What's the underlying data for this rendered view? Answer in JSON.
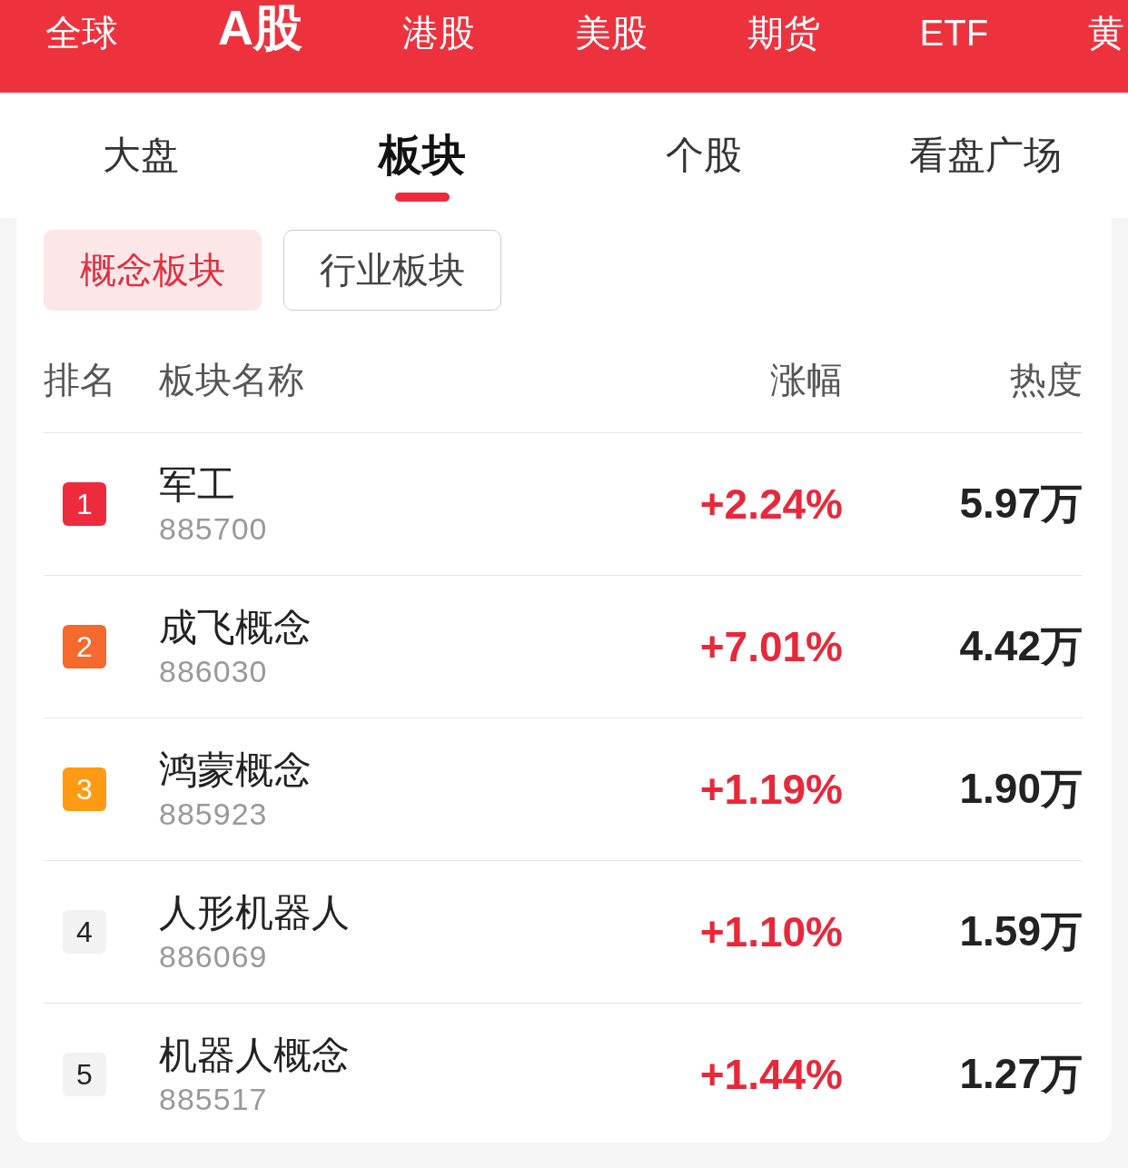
{
  "market_tabs": [
    {
      "label": "全球",
      "selected": false
    },
    {
      "label": "A股",
      "selected": true
    },
    {
      "label": "港股",
      "selected": false
    },
    {
      "label": "美股",
      "selected": false
    },
    {
      "label": "期货",
      "selected": false
    },
    {
      "label": "ETF",
      "selected": false
    },
    {
      "label": "黄",
      "selected": false
    }
  ],
  "section_tabs": [
    {
      "label": "大盘",
      "selected": false
    },
    {
      "label": "板块",
      "selected": true
    },
    {
      "label": "个股",
      "selected": false
    },
    {
      "label": "看盘广场",
      "selected": false
    }
  ],
  "category_toggle": [
    {
      "label": "概念板块",
      "selected": true
    },
    {
      "label": "行业板块",
      "selected": false
    }
  ],
  "table": {
    "columns": [
      "排名",
      "板块名称",
      "涨幅",
      "热度"
    ],
    "rows": [
      {
        "rank": "1",
        "name": "军工",
        "code": "885700",
        "change": "+2.24%",
        "heat": "5.97万",
        "color": "#ee2a3d"
      },
      {
        "rank": "2",
        "name": "成飞概念",
        "code": "886030",
        "change": "+7.01%",
        "heat": "4.42万",
        "color": "#f5692c"
      },
      {
        "rank": "3",
        "name": "鸿蒙概念",
        "code": "885923",
        "change": "+1.19%",
        "heat": "1.90万",
        "color": "#ff9a12"
      },
      {
        "rank": "4",
        "name": "人形机器人",
        "code": "886069",
        "change": "+1.10%",
        "heat": "1.59万",
        "color": "#f2f2f2"
      },
      {
        "rank": "5",
        "name": "机器人概念",
        "code": "885517",
        "change": "+1.44%",
        "heat": "1.27万",
        "color": "#f2f2f2"
      }
    ]
  }
}
